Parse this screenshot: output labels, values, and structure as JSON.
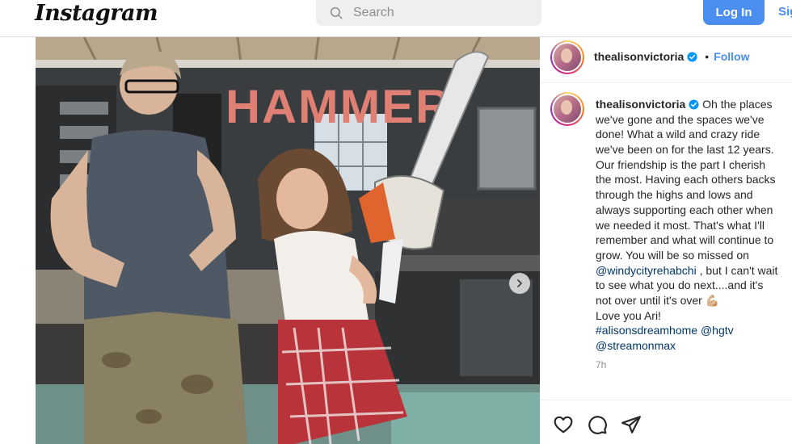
{
  "topbar": {
    "logo": "Instagram",
    "search_placeholder": "Search",
    "login_label": "Log In",
    "signup_label": "Sig"
  },
  "post": {
    "photo_sign_text": "HAMMER",
    "next_button": "chevron-right-icon"
  },
  "sidebar": {
    "username": "thealisonvictoria",
    "separator": "•",
    "follow_label": "Follow",
    "more_label": "⋮",
    "caption": {
      "user": "thealisonvictoria",
      "lines": [
        "Oh the places",
        "we've gone and the spaces we've",
        "done! What a wild and crazy ride",
        "we've been on for the last 12 years.",
        "Our friendship is the part I cherish",
        "the most. Having each others backs",
        "through the highs and lows and",
        "always supporting each other when",
        "we needed it most. That's what I'll",
        "remember and what will continue to",
        "grow. You will be so missed on"
      ],
      "mention_1": "@windycityrehabchi",
      "after_mention_1": " , but I can't wait",
      "line_13": "to see what you do next....and it's",
      "line_14": "not over until it's over 💪🏼",
      "line_15": "Love you Ari!",
      "hashtag": "#alisonsdreamhome",
      "mention_2": "@hgtv",
      "mention_3": "@streamonmax"
    },
    "time": "7h"
  },
  "colors": {
    "accent": "#4a8ff0",
    "link": "#00376b",
    "muted": "#8e8e8e"
  }
}
